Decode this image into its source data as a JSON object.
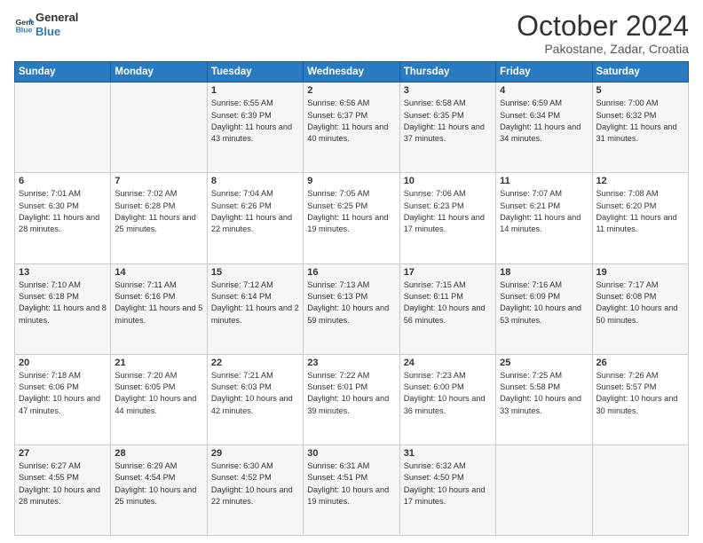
{
  "header": {
    "logo_line1": "General",
    "logo_line2": "Blue",
    "month": "October 2024",
    "location": "Pakostane, Zadar, Croatia"
  },
  "weekdays": [
    "Sunday",
    "Monday",
    "Tuesday",
    "Wednesday",
    "Thursday",
    "Friday",
    "Saturday"
  ],
  "weeks": [
    [
      {
        "day": "",
        "sunrise": "",
        "sunset": "",
        "daylight": ""
      },
      {
        "day": "",
        "sunrise": "",
        "sunset": "",
        "daylight": ""
      },
      {
        "day": "1",
        "sunrise": "Sunrise: 6:55 AM",
        "sunset": "Sunset: 6:39 PM",
        "daylight": "Daylight: 11 hours and 43 minutes."
      },
      {
        "day": "2",
        "sunrise": "Sunrise: 6:56 AM",
        "sunset": "Sunset: 6:37 PM",
        "daylight": "Daylight: 11 hours and 40 minutes."
      },
      {
        "day": "3",
        "sunrise": "Sunrise: 6:58 AM",
        "sunset": "Sunset: 6:35 PM",
        "daylight": "Daylight: 11 hours and 37 minutes."
      },
      {
        "day": "4",
        "sunrise": "Sunrise: 6:59 AM",
        "sunset": "Sunset: 6:34 PM",
        "daylight": "Daylight: 11 hours and 34 minutes."
      },
      {
        "day": "5",
        "sunrise": "Sunrise: 7:00 AM",
        "sunset": "Sunset: 6:32 PM",
        "daylight": "Daylight: 11 hours and 31 minutes."
      }
    ],
    [
      {
        "day": "6",
        "sunrise": "Sunrise: 7:01 AM",
        "sunset": "Sunset: 6:30 PM",
        "daylight": "Daylight: 11 hours and 28 minutes."
      },
      {
        "day": "7",
        "sunrise": "Sunrise: 7:02 AM",
        "sunset": "Sunset: 6:28 PM",
        "daylight": "Daylight: 11 hours and 25 minutes."
      },
      {
        "day": "8",
        "sunrise": "Sunrise: 7:04 AM",
        "sunset": "Sunset: 6:26 PM",
        "daylight": "Daylight: 11 hours and 22 minutes."
      },
      {
        "day": "9",
        "sunrise": "Sunrise: 7:05 AM",
        "sunset": "Sunset: 6:25 PM",
        "daylight": "Daylight: 11 hours and 19 minutes."
      },
      {
        "day": "10",
        "sunrise": "Sunrise: 7:06 AM",
        "sunset": "Sunset: 6:23 PM",
        "daylight": "Daylight: 11 hours and 17 minutes."
      },
      {
        "day": "11",
        "sunrise": "Sunrise: 7:07 AM",
        "sunset": "Sunset: 6:21 PM",
        "daylight": "Daylight: 11 hours and 14 minutes."
      },
      {
        "day": "12",
        "sunrise": "Sunrise: 7:08 AM",
        "sunset": "Sunset: 6:20 PM",
        "daylight": "Daylight: 11 hours and 11 minutes."
      }
    ],
    [
      {
        "day": "13",
        "sunrise": "Sunrise: 7:10 AM",
        "sunset": "Sunset: 6:18 PM",
        "daylight": "Daylight: 11 hours and 8 minutes."
      },
      {
        "day": "14",
        "sunrise": "Sunrise: 7:11 AM",
        "sunset": "Sunset: 6:16 PM",
        "daylight": "Daylight: 11 hours and 5 minutes."
      },
      {
        "day": "15",
        "sunrise": "Sunrise: 7:12 AM",
        "sunset": "Sunset: 6:14 PM",
        "daylight": "Daylight: 11 hours and 2 minutes."
      },
      {
        "day": "16",
        "sunrise": "Sunrise: 7:13 AM",
        "sunset": "Sunset: 6:13 PM",
        "daylight": "Daylight: 10 hours and 59 minutes."
      },
      {
        "day": "17",
        "sunrise": "Sunrise: 7:15 AM",
        "sunset": "Sunset: 6:11 PM",
        "daylight": "Daylight: 10 hours and 56 minutes."
      },
      {
        "day": "18",
        "sunrise": "Sunrise: 7:16 AM",
        "sunset": "Sunset: 6:09 PM",
        "daylight": "Daylight: 10 hours and 53 minutes."
      },
      {
        "day": "19",
        "sunrise": "Sunrise: 7:17 AM",
        "sunset": "Sunset: 6:08 PM",
        "daylight": "Daylight: 10 hours and 50 minutes."
      }
    ],
    [
      {
        "day": "20",
        "sunrise": "Sunrise: 7:18 AM",
        "sunset": "Sunset: 6:06 PM",
        "daylight": "Daylight: 10 hours and 47 minutes."
      },
      {
        "day": "21",
        "sunrise": "Sunrise: 7:20 AM",
        "sunset": "Sunset: 6:05 PM",
        "daylight": "Daylight: 10 hours and 44 minutes."
      },
      {
        "day": "22",
        "sunrise": "Sunrise: 7:21 AM",
        "sunset": "Sunset: 6:03 PM",
        "daylight": "Daylight: 10 hours and 42 minutes."
      },
      {
        "day": "23",
        "sunrise": "Sunrise: 7:22 AM",
        "sunset": "Sunset: 6:01 PM",
        "daylight": "Daylight: 10 hours and 39 minutes."
      },
      {
        "day": "24",
        "sunrise": "Sunrise: 7:23 AM",
        "sunset": "Sunset: 6:00 PM",
        "daylight": "Daylight: 10 hours and 36 minutes."
      },
      {
        "day": "25",
        "sunrise": "Sunrise: 7:25 AM",
        "sunset": "Sunset: 5:58 PM",
        "daylight": "Daylight: 10 hours and 33 minutes."
      },
      {
        "day": "26",
        "sunrise": "Sunrise: 7:26 AM",
        "sunset": "Sunset: 5:57 PM",
        "daylight": "Daylight: 10 hours and 30 minutes."
      }
    ],
    [
      {
        "day": "27",
        "sunrise": "Sunrise: 6:27 AM",
        "sunset": "Sunset: 4:55 PM",
        "daylight": "Daylight: 10 hours and 28 minutes."
      },
      {
        "day": "28",
        "sunrise": "Sunrise: 6:29 AM",
        "sunset": "Sunset: 4:54 PM",
        "daylight": "Daylight: 10 hours and 25 minutes."
      },
      {
        "day": "29",
        "sunrise": "Sunrise: 6:30 AM",
        "sunset": "Sunset: 4:52 PM",
        "daylight": "Daylight: 10 hours and 22 minutes."
      },
      {
        "day": "30",
        "sunrise": "Sunrise: 6:31 AM",
        "sunset": "Sunset: 4:51 PM",
        "daylight": "Daylight: 10 hours and 19 minutes."
      },
      {
        "day": "31",
        "sunrise": "Sunrise: 6:32 AM",
        "sunset": "Sunset: 4:50 PM",
        "daylight": "Daylight: 10 hours and 17 minutes."
      },
      {
        "day": "",
        "sunrise": "",
        "sunset": "",
        "daylight": ""
      },
      {
        "day": "",
        "sunrise": "",
        "sunset": "",
        "daylight": ""
      }
    ]
  ]
}
